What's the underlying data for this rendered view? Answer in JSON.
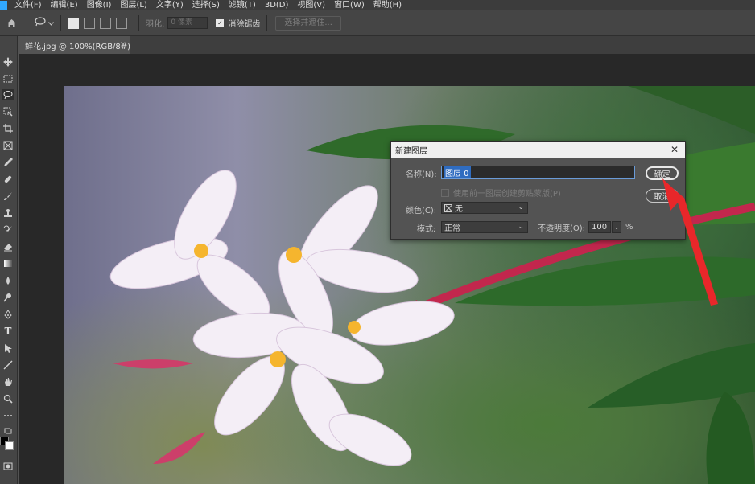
{
  "menubar": {
    "items": [
      "文件(F)",
      "编辑(E)",
      "图像(I)",
      "图层(L)",
      "文字(Y)",
      "选择(S)",
      "滤镜(T)",
      "3D(D)",
      "视图(V)",
      "窗口(W)",
      "帮助(H)"
    ]
  },
  "options_bar": {
    "feather_label": "羽化:",
    "feather_value": "0 像素",
    "antialias_label": "消除锯齿",
    "select_mask_label": "选择并遮住..."
  },
  "tab": {
    "title": "鲜花.jpg @ 100%(RGB/8#)",
    "close": "×"
  },
  "toolbar": {
    "type_tool_glyph": "T"
  },
  "dialog": {
    "title": "新建图层",
    "close": "✕",
    "name_label": "名称(N):",
    "name_value": "图层 0",
    "clipping_mask_label": "使用前一图层创建剪贴蒙版(P)",
    "color_label": "颜色(C):",
    "color_value": "无",
    "mode_label": "模式:",
    "mode_value": "正常",
    "opacity_label": "不透明度(O):",
    "opacity_value": "100",
    "opacity_unit": "%",
    "ok_label": "确定",
    "cancel_label": "取消"
  },
  "colors": {
    "menubar_bg": "#3c3c3c",
    "panel_bg": "#454545",
    "canvas_bg": "#282828",
    "selection_blue": "#2f6cc0",
    "annotation_red": "#e8272a"
  }
}
